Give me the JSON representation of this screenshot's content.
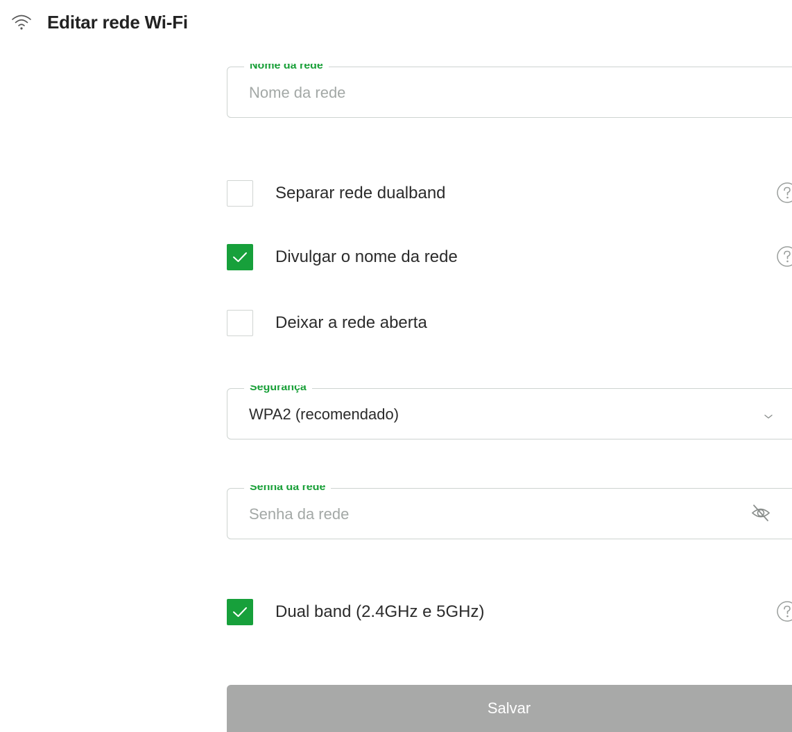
{
  "header": {
    "icon": "wifi-icon",
    "title": "Editar rede Wi-Fi"
  },
  "form": {
    "network_name": {
      "label": "Nome da rede",
      "value": "",
      "placeholder": "Nome da rede"
    },
    "options": [
      {
        "label": "Separar rede dualband",
        "checked": false,
        "help": true
      },
      {
        "label": "Divulgar o nome da rede",
        "checked": true,
        "help": true
      },
      {
        "label": "Deixar a rede aberta",
        "checked": false,
        "help": false
      }
    ],
    "security": {
      "label": "Segurança",
      "selected": "WPA2 (recomendado)"
    },
    "password": {
      "label": "Senha da rede",
      "value": "",
      "placeholder": "Senha da rede",
      "toggle_icon": "eye-off-icon"
    },
    "dual_band": {
      "label": "Dual band (2.4GHz e 5GHz)",
      "checked": true,
      "help": true
    },
    "save_label": "Salvar"
  },
  "colors": {
    "accent": "#17a03b",
    "label_green": "#1aa039",
    "border": "#cdd3d0",
    "placeholder": "#a3a8a6",
    "button_disabled": "#a8a9a8"
  }
}
